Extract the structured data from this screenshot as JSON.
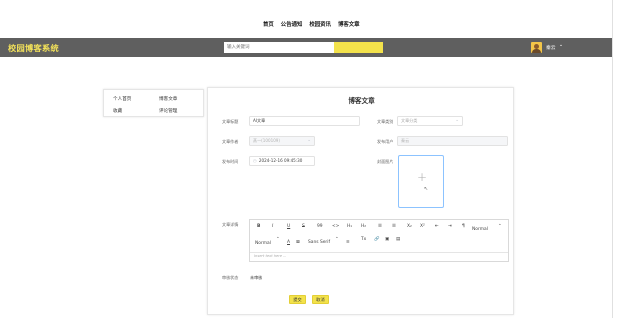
{
  "nav": {
    "links": [
      "首页",
      "公告通知",
      "校园资讯",
      "博客文章"
    ]
  },
  "header": {
    "brand": "校园博客系统",
    "search_placeholder": "输入关键词",
    "user_name": "秦云",
    "user_chevron": "⌄"
  },
  "menu": {
    "items": [
      "个人首页",
      "博客文章",
      "收藏",
      "评论管理"
    ]
  },
  "form": {
    "title": "博客文章",
    "labels": {
      "title": "文章标题",
      "category": "文章类别",
      "author": "文章作者",
      "publisher": "发布用户",
      "time": "发布时间",
      "cover": "封面图片",
      "content": "文章详情",
      "status": "审核状态"
    },
    "values": {
      "title": "AI文章",
      "category_placeholder": "文章分类",
      "author": "蒸一(100109)",
      "publisher": "秦云",
      "time": "2024-12-16 09:45:30",
      "status": "未审核"
    },
    "editor": {
      "row1": [
        "B",
        "I",
        "U",
        "S",
        "99",
        "<>",
        "H₁",
        "H₂",
        "☰",
        "☰",
        "X₂",
        "X²",
        "⇤",
        "⇥",
        "¶",
        "Normal",
        "⌃"
      ],
      "row2": [
        "Normal",
        "⌃",
        "A",
        "⊠",
        "Sans Serif",
        "⌃",
        "≡",
        "Tx",
        "🔗",
        "▣",
        "▤"
      ],
      "placeholder": "Insert text here ..."
    },
    "buttons": {
      "submit": "提交",
      "cancel": "取消"
    }
  },
  "colors": {
    "accent": "#f3e24b",
    "header_bg": "#5f5f5f",
    "brand_text": "#f2e15a"
  }
}
